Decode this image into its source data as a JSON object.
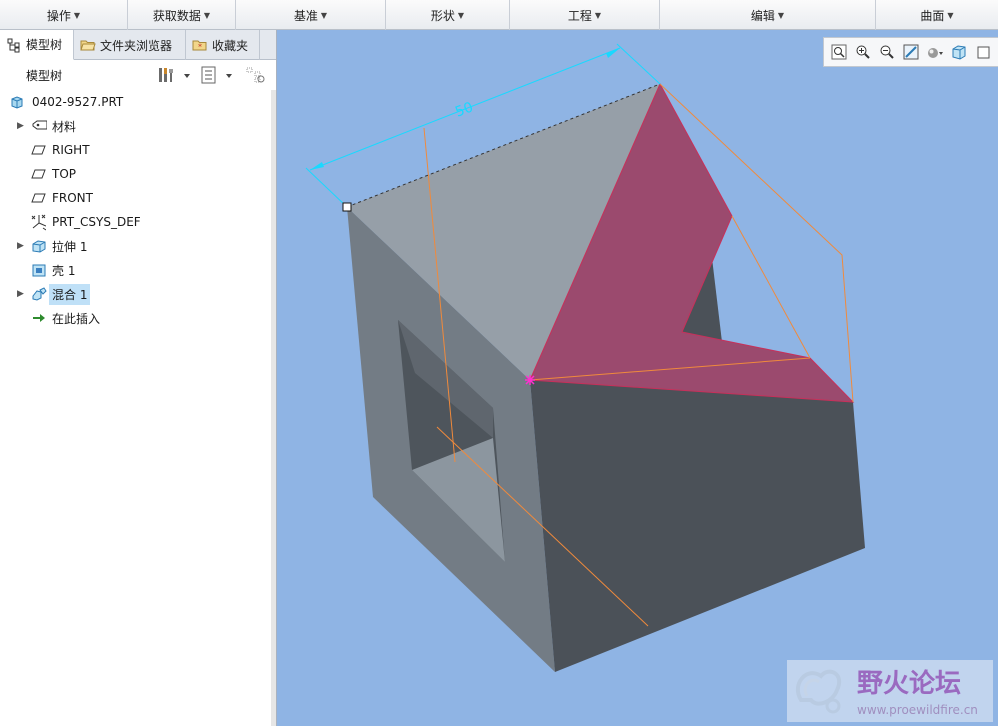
{
  "ribbon": {
    "items": [
      {
        "label": "操作",
        "w": 128
      },
      {
        "label": "获取数据",
        "w": 108
      },
      {
        "label": "基准",
        "w": 150
      },
      {
        "label": "形状",
        "w": 124
      },
      {
        "label": "工程",
        "w": 150
      },
      {
        "label": "编辑",
        "w": 216
      },
      {
        "label": "曲面",
        "w": 122
      }
    ]
  },
  "left_panel": {
    "tabs": [
      {
        "label": "模型树"
      },
      {
        "label": "文件夹浏览器"
      },
      {
        "label": "收藏夹"
      }
    ],
    "tree_title": "模型树",
    "items": [
      {
        "label": "0402-9527.PRT",
        "icon": "part-icon",
        "expand": false
      },
      {
        "label": "材料",
        "icon": "material-icon",
        "expand": true
      },
      {
        "label": "RIGHT",
        "icon": "datum-plane-icon",
        "expand": false
      },
      {
        "label": "TOP",
        "icon": "datum-plane-icon",
        "expand": false
      },
      {
        "label": "FRONT",
        "icon": "datum-plane-icon",
        "expand": false
      },
      {
        "label": "PRT_CSYS_DEF",
        "icon": "csys-icon",
        "expand": false
      },
      {
        "label": "拉伸 1",
        "icon": "extrude-icon",
        "expand": true
      },
      {
        "label": "壳 1",
        "icon": "shell-icon",
        "expand": false
      },
      {
        "label": "混合 1",
        "icon": "blend-icon",
        "expand": true,
        "selected": true
      },
      {
        "label": "在此插入",
        "icon": "insert-here-icon",
        "expand": false
      }
    ]
  },
  "viewport": {
    "dimension_value": "50",
    "watermark_text": "野火论坛",
    "watermark_url": "www.proewildfire.cn"
  },
  "colors": {
    "viewport_bg": "#8fb4e4",
    "blend_surface": "#9b4a6e",
    "dimension": "#19d9ff",
    "datum_line": "#f08a3c"
  }
}
